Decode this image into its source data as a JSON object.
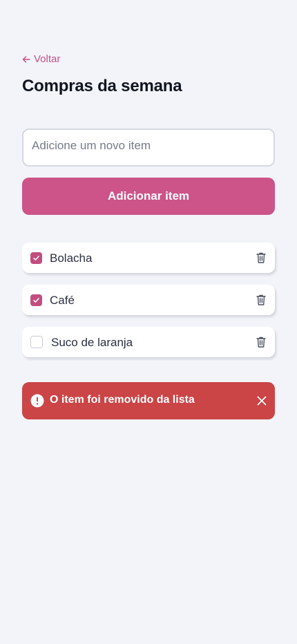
{
  "nav": {
    "back_label": "Voltar"
  },
  "header": {
    "title": "Compras da semana"
  },
  "form": {
    "input_placeholder": "Adicione um novo item",
    "input_value": "",
    "add_button_label": "Adicionar item"
  },
  "items": [
    {
      "label": "Bolacha",
      "checked": true
    },
    {
      "label": "Café",
      "checked": true
    },
    {
      "label": "Suco de laranja",
      "checked": false
    }
  ],
  "toast": {
    "message": "O item foi removido da lista",
    "type": "error"
  },
  "colors": {
    "accent": "#cc5489",
    "checkbox": "#c24d80",
    "error": "#cb4446",
    "background": "#f3f4f9"
  },
  "icons": {
    "back": "arrow-left-icon",
    "delete": "trash-icon",
    "check": "check-icon",
    "alert": "alert-circle-icon",
    "close": "close-icon"
  }
}
